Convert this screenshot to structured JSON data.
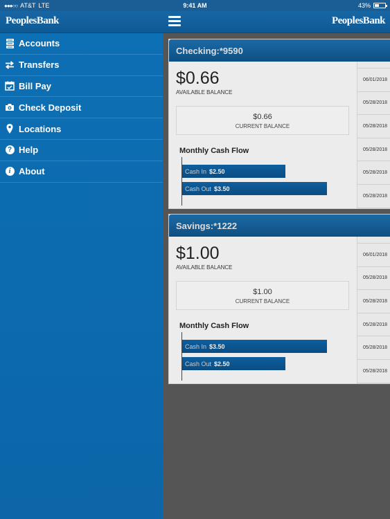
{
  "status": {
    "signal": "●●●○○",
    "carrier": "AT&T",
    "network": "LTE",
    "time": "9:41 AM",
    "battery": "43%"
  },
  "header": {
    "logo_left": "PeoplesBank",
    "logo_right": "PeoplesBank"
  },
  "sidebar": {
    "items": [
      {
        "label": "Accounts",
        "icon": "accounts-icon"
      },
      {
        "label": "Transfers",
        "icon": "transfer-arrows-icon"
      },
      {
        "label": "Bill Pay",
        "icon": "calendar-check-icon"
      },
      {
        "label": "Check Deposit",
        "icon": "camera-icon"
      },
      {
        "label": "Locations",
        "icon": "map-pin-icon"
      },
      {
        "label": "Help",
        "icon": "question-icon"
      },
      {
        "label": "About",
        "icon": "info-icon"
      }
    ]
  },
  "accounts": [
    {
      "title": "Checking:*9590",
      "available_balance": "$0.66",
      "available_label": "AVAILABLE BALANCE",
      "current_balance": "$0.66",
      "current_label": "CURRENT BALANCE",
      "cashflow_title": "Monthly Cash Flow",
      "cash_in_label": "Cash In",
      "cash_in": "$2.50",
      "cash_in_value": 2.5,
      "cash_out_label": "Cash Out",
      "cash_out": "$3.50",
      "cash_out_value": 3.5,
      "dates": [
        "06/01/2018",
        "05/28/2018",
        "05/28/2018",
        "05/28/2018",
        "05/28/2018",
        "05/28/2018"
      ]
    },
    {
      "title": "Savings:*1222",
      "available_balance": "$1.00",
      "available_label": "AVAILABLE BALANCE",
      "current_balance": "$1.00",
      "current_label": "CURRENT BALANCE",
      "cashflow_title": "Monthly Cash Flow",
      "cash_in_label": "Cash In",
      "cash_in": "$3.50",
      "cash_in_value": 3.5,
      "cash_out_label": "Cash Out",
      "cash_out": "$2.50",
      "cash_out_value": 2.5,
      "dates": [
        "06/01/2018",
        "05/28/2018",
        "05/28/2018",
        "05/28/2018",
        "05/28/2018",
        "05/28/2018"
      ]
    }
  ]
}
